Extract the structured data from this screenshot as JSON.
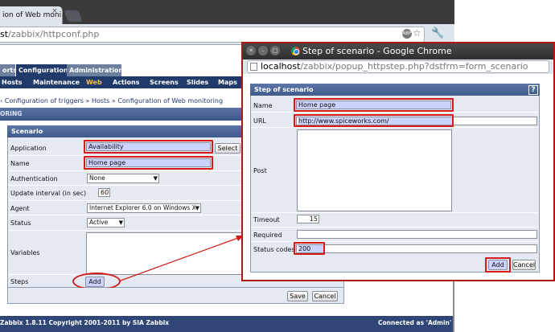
{
  "main_window": {
    "tab_title": "ion of Web moni",
    "tab_close": "×",
    "url_host": "st",
    "url_path": "/zabbix/httpconf.php",
    "abp": "ABP",
    "star": "☆",
    "wrench": "🔧"
  },
  "menu": {
    "top": [
      {
        "label": "orts"
      },
      {
        "label": "Configuration"
      },
      {
        "label": "Administration"
      }
    ],
    "sub": [
      "Hosts",
      "Maintenance",
      "Web",
      "Actions",
      "Screens",
      "Slides",
      "Maps"
    ]
  },
  "breadcrumb": "› Configuration of triggers » Hosts » Configuration of Web monitoring",
  "section_title": "ORING",
  "scenario_form": {
    "title": "Scenario",
    "application_label": "Application",
    "application_value": "Availability",
    "select_button": "Select",
    "name_label": "Name",
    "name_value": "Home page",
    "authentication_label": "Authentication",
    "authentication_value": "None",
    "update_interval_label": "Update interval (in sec)",
    "update_interval_value": "60",
    "agent_label": "Agent",
    "agent_value": "Internet Explorer 6.0 on Windows XP",
    "status_label": "Status",
    "status_value": "Active",
    "variables_label": "Variables",
    "steps_label": "Steps",
    "add_button": "Add",
    "save_button": "Save",
    "cancel_button": "Cancel"
  },
  "footer": {
    "copyright": "Zabbix 1.8.11 Copyright 2001-2011 by SIA Zabbix",
    "connected": "Connected as 'Admin'"
  },
  "popup": {
    "window_title": "Step of scenario - Google Chrome",
    "url_host": "localhost",
    "url_path": "/zabbix/popup_httpstep.php?dstfrm=form_scenario",
    "form_title": "Step of scenario",
    "help": "?",
    "name_label": "Name",
    "name_value": "Home page",
    "url_label": "URL",
    "url_value": "http://www.spiceworks.com/",
    "post_label": "Post",
    "timeout_label": "Timeout",
    "timeout_value": "15",
    "required_label": "Required",
    "required_value": "",
    "status_codes_label": "Status codes",
    "status_codes_value": "200",
    "add_button": "Add",
    "cancel_button": "Cancel"
  },
  "colors": {
    "highlight": "#d41a1a",
    "zabbix_nav": "#203a6a",
    "active_menu": "#f6c24a",
    "field_highlight": "#cdd3ff"
  }
}
